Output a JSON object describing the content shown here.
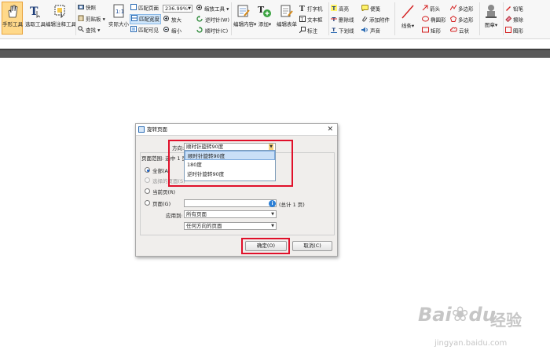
{
  "ribbon": {
    "hand_tool": "手形工具",
    "select_text": "选取工具",
    "edit_annot": "编辑注释工具",
    "snapshot": "快照",
    "clipboard": "剪贴板",
    "find": "查找",
    "actual_size": "实际大小",
    "fit_page": "匹配页面",
    "fit_width": "匹配宽度",
    "fit_visible": "匹配可见",
    "zoom_value": "236.99%",
    "zoom_tool": "缩放工具",
    "zoom_in": "放大",
    "zoom_out": "缩小",
    "rotate_ccw": "逆时针(W)",
    "rotate_cw": "顺时针(C)",
    "edit_content": "编辑内容",
    "add": "添加",
    "edit_form": "编辑表单",
    "typewriter": "打字机",
    "textbox": "文本框",
    "callout": "标注",
    "highlight": "高亮",
    "strikeout": "删除线",
    "underline": "下划线",
    "note": "便笺",
    "attach_file": "添加附件",
    "sound": "声音",
    "line": "线条",
    "arrow": "箭头",
    "ellipse": "椭圆形",
    "rectangle": "矩形",
    "polygon": "多边形",
    "polyline": "多边形",
    "cloud": "云状",
    "stamp": "图章",
    "pencil": "铅笔",
    "eraser": "擦除",
    "shape_more": "图形"
  },
  "dialog": {
    "title": "旋转页面",
    "close": "✕",
    "direction_label": "方向:",
    "direction_value": "顺时针旋转90度",
    "direction_options": [
      "顺时针旋转90度",
      "180度",
      "逆时针旋转90度"
    ],
    "page_range_label": "页面范围: 选中 1 页",
    "opt_all": "全部(A)",
    "opt_selected": "选择的页面(S)",
    "opt_current": "当前页(R)",
    "opt_pages": "页面(G)",
    "pages_total": "(总计 1 页)",
    "apply_to_label": "应用到:",
    "apply_to_value": "所有页面",
    "orientation_value": "任何方向的页面",
    "ok": "确定(O)",
    "cancel": "取消(C)"
  },
  "watermark": {
    "brand": "Bai",
    "brand2": "du",
    "jingyan": "经验",
    "url": "jingyan.baidu.com"
  },
  "colors": {
    "highlight_red": "#e0102a",
    "selection_blue": "#c9dff7"
  }
}
